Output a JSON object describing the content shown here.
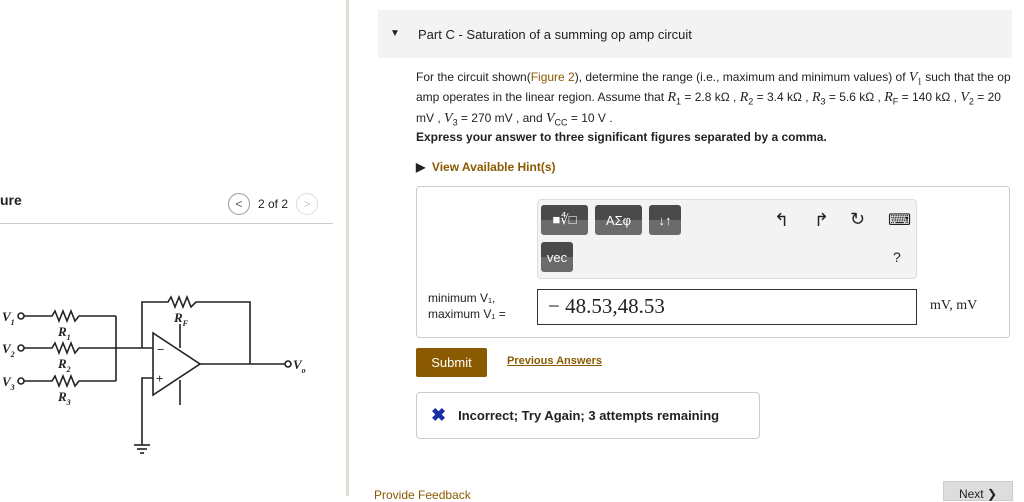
{
  "figure": {
    "title": "ure",
    "pager": "2 of 2",
    "labels": {
      "v1": "V",
      "v1s": "1",
      "v2": "V",
      "v2s": "2",
      "v3": "V",
      "v3s": "3",
      "r1": "R",
      "r1s": "1",
      "r2": "R",
      "r2s": "2",
      "r3": "R",
      "r3s": "3",
      "rf": "R",
      "rfs": "F",
      "vo": "V",
      "vos": "o",
      "minus": "−",
      "plus": "+"
    }
  },
  "part": {
    "title": "Part C - Saturation of a summing op amp circuit"
  },
  "prompt": {
    "t1": "For the circuit shown(",
    "fig_link": "Figure 2",
    "t2": "), determine the range (i.e., maximum and minimum values) of ",
    "v1": "V",
    "v1s": "1",
    "t3": " such that the op amp operates in the linear region. Assume that ",
    "r1": "R",
    "r1s": "1",
    "r1v": " = 2.8 kΩ , ",
    "r2": "R",
    "r2s": "2",
    "r2v": " = 3.4 kΩ , ",
    "r3": "R",
    "r3s": "3",
    "r3v": " = 5.6 kΩ , ",
    "rf": "R",
    "rfs": "F",
    "rfv": " = 140 kΩ , ",
    "v2": "V",
    "v2s": "2",
    "v2v": " = 20 mV , ",
    "v3": "V",
    "v3s": "3",
    "v3v": " = 270 mV , and ",
    "vcc": "V",
    "vccs": "CC",
    "vccv": " = 10 V ."
  },
  "express": "Express your answer to three significant figures separated by a comma.",
  "hint": "View Available Hint(s)",
  "toolbar": {
    "templates": "■∜□",
    "greek": "ΑΣφ",
    "arrows": "↓↑",
    "vec": "vec",
    "undo": "↰",
    "redo": "↱",
    "reset": "↻",
    "keyboard": "⌨",
    "help": "?"
  },
  "answer": {
    "label1": "minimum V₁,",
    "label2": "maximum V₁ =",
    "value": "− 48.53,48.53",
    "units": "mV, mV"
  },
  "submit": "Submit",
  "previous_answers": "Previous Answers",
  "feedback": {
    "icon": "✖",
    "text": "Incorrect; Try Again; 3 attempts remaining"
  },
  "provide_feedback": "Provide Feedback",
  "next": "Next ❯"
}
